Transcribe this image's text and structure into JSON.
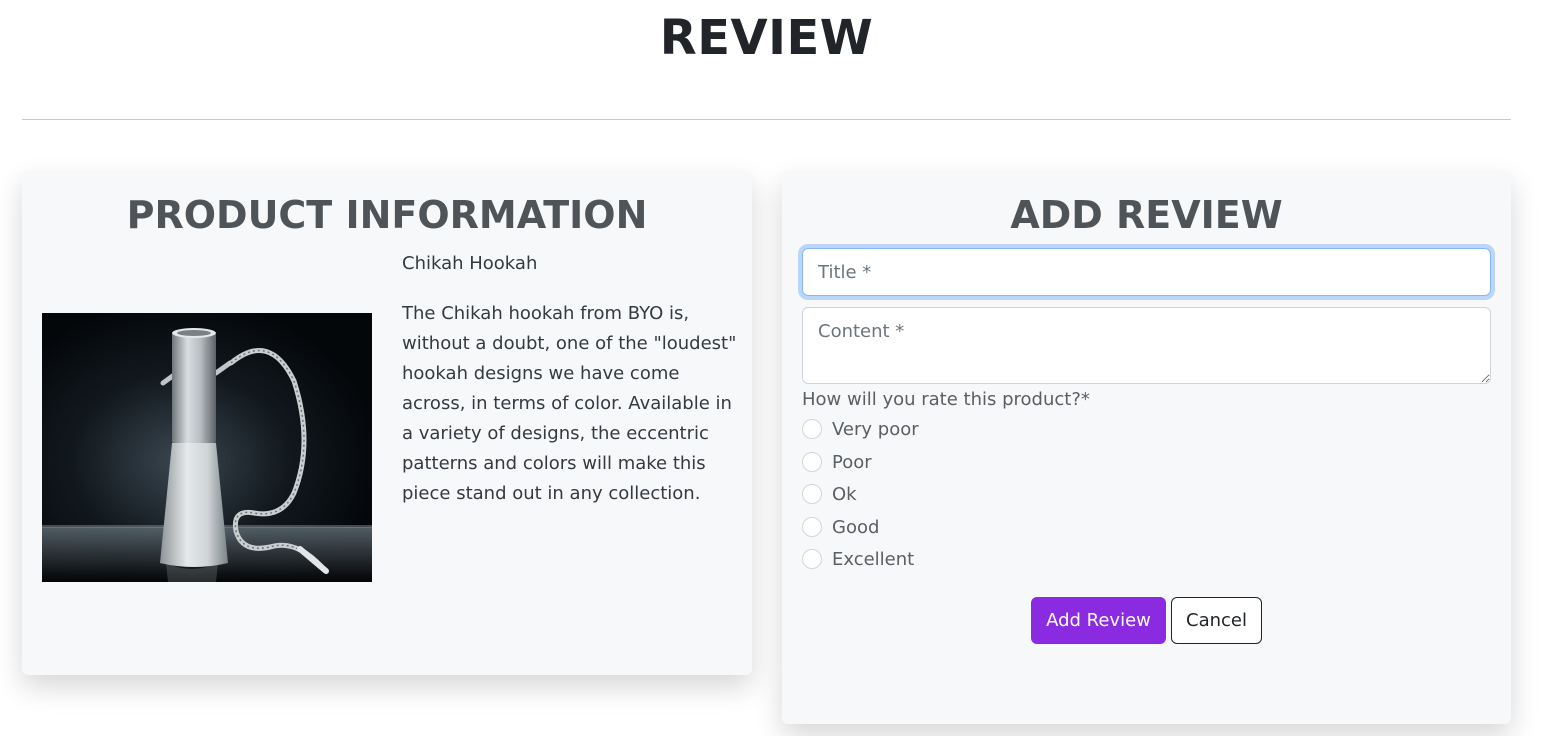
{
  "page": {
    "title": "REVIEW"
  },
  "product": {
    "heading": "PRODUCT INFORMATION",
    "name": "Chikah Hookah",
    "description": "The Chikah hookah from BYO is, without a doubt, one of the \"loudest\" hookah designs we have come across, in terms of color. Available in a variety of designs, the eccentric patterns and colors will make this piece stand out in any collection."
  },
  "review_form": {
    "heading": "ADD REVIEW",
    "title_placeholder": "Title *",
    "title_value": "",
    "content_placeholder": "Content *",
    "content_value": "",
    "rating_question": "How will you rate this product?*",
    "rating_options": [
      "Very poor",
      "Poor",
      "Ok",
      "Good",
      "Excellent"
    ],
    "submit_label": "Add Review",
    "cancel_label": "Cancel"
  },
  "colors": {
    "accent": "#8a2be2",
    "card_background": "#f7f8fa",
    "focus_ring": "#86b7fe"
  }
}
